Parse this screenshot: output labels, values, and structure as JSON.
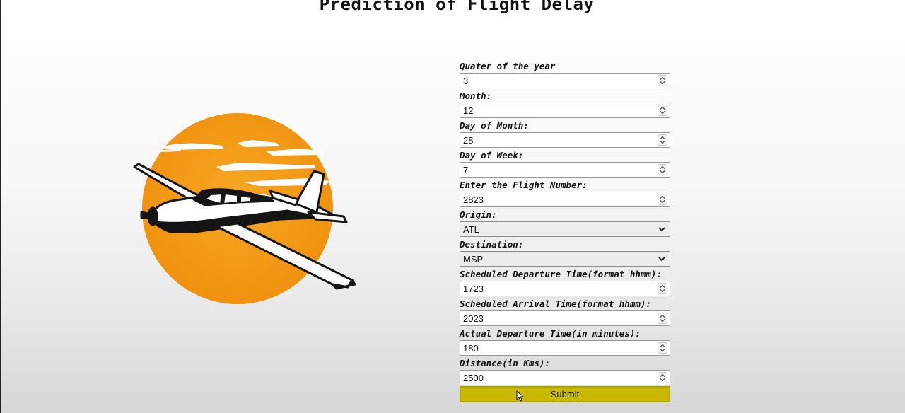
{
  "page": {
    "title": "Prediction of Flight Delay"
  },
  "logo": {
    "icon": "airplane-sun-logo",
    "colors": {
      "sun": "#f29a12",
      "sun_light": "#f5b43a",
      "plane": "#1a1a1a",
      "plane_body": "#ffffff"
    }
  },
  "form": {
    "fields": [
      {
        "label": "Quater of the year",
        "value": "3",
        "type": "number"
      },
      {
        "label": "Month:",
        "value": "12",
        "type": "number"
      },
      {
        "label": "Day of Month:",
        "value": "28",
        "type": "number"
      },
      {
        "label": "Day of Week:",
        "value": "7",
        "type": "number"
      },
      {
        "label": "Enter the Flight Number:",
        "value": "2823",
        "type": "number"
      },
      {
        "label": "Origin:",
        "value": "ATL",
        "type": "select"
      },
      {
        "label": "Destination:",
        "value": "MSP",
        "type": "select"
      },
      {
        "label": "Scheduled Departure Time(format hhmm):",
        "value": "1723",
        "type": "number"
      },
      {
        "label": "Scheduled Arrival Time(format hhmm):",
        "value": "2023",
        "type": "number"
      },
      {
        "label": "Actual Departure Time(in minutes):",
        "value": "180",
        "type": "number"
      },
      {
        "label": "Distance(in Kms):",
        "value": "2500",
        "type": "number"
      }
    ],
    "submit_label": "Submit",
    "submit_color": "#c9b800"
  }
}
